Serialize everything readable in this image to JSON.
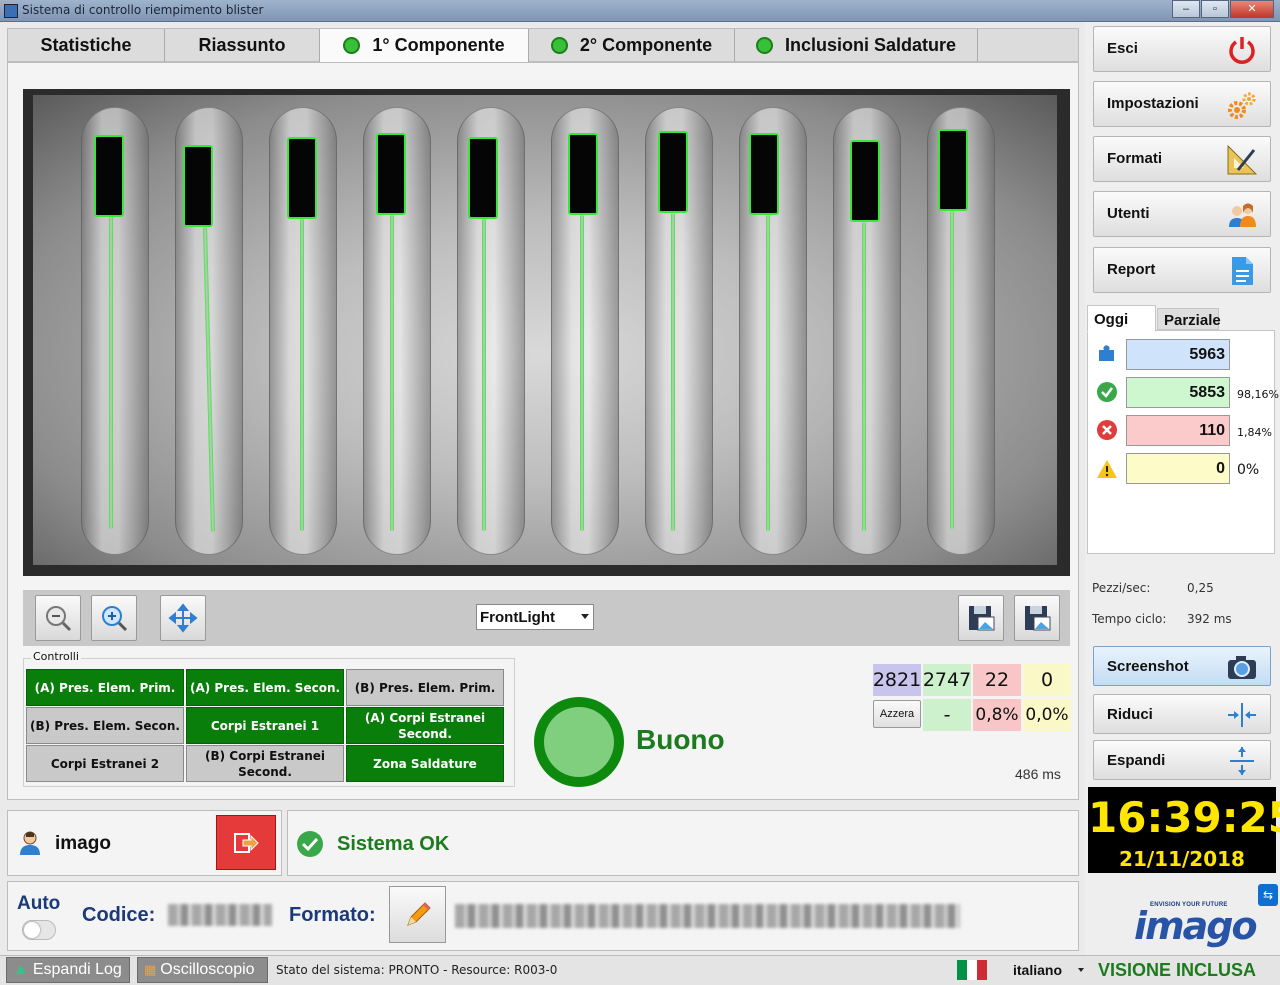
{
  "window": {
    "title": "Sistema di controllo riempimento blister",
    "controls": [
      "minimize",
      "maximize",
      "close"
    ]
  },
  "tabs": [
    {
      "label": "Statistiche",
      "status": null
    },
    {
      "label": "Riassunto",
      "status": null
    },
    {
      "label": "1° Componente",
      "status": "ok",
      "active": true
    },
    {
      "label": "2° Componente",
      "status": "ok"
    },
    {
      "label": "Inclusioni Saldature",
      "status": "ok"
    }
  ],
  "image_toolbar": {
    "light_select": "FrontLight",
    "zoom_out_icon": "zoom-out-icon",
    "zoom_in_icon": "zoom-in-icon",
    "fit_icon": "move-arrows-icon",
    "save_icon": "save-image-icon"
  },
  "controlli": {
    "title": "Controlli",
    "cells": [
      {
        "label": "(A) Pres. Elem. Prim.",
        "state": "ok"
      },
      {
        "label": "(A) Pres. Elem. Secon.",
        "state": "ok"
      },
      {
        "label": "(B) Pres. Elem. Prim.",
        "state": "off"
      },
      {
        "label": "(B) Pres. Elem. Secon.",
        "state": "off"
      },
      {
        "label": "Corpi Estranei 1",
        "state": "ok"
      },
      {
        "label": "(A) Corpi Estranei Second.",
        "state": "ok"
      },
      {
        "label": "Corpi Estranei 2",
        "state": "off"
      },
      {
        "label": "(B) Corpi Estranei Second.",
        "state": "off"
      },
      {
        "label": "Zona Saldature",
        "state": "ok"
      }
    ]
  },
  "result": {
    "label": "Buono",
    "color": "#1e7a1e"
  },
  "counters": {
    "total": "2821",
    "good": "2747",
    "bad": "22",
    "warn": "0",
    "reset_label": "Azzera",
    "good_pct": "-",
    "bad_pct": "0,8%",
    "warn_pct": "0,0%",
    "cycle_time": "486 ms"
  },
  "user": {
    "name": "imago",
    "user_icon": "user-icon",
    "logout_icon": "logout-icon"
  },
  "system_status": {
    "label": "Sistema OK",
    "icon": "check-circle-icon"
  },
  "code_bar": {
    "auto_label": "Auto",
    "auto_enabled": false,
    "codice_label": "Codice:",
    "formato_label": "Formato:",
    "edit_icon": "pencil-icon"
  },
  "bottom": {
    "log_button": "Espandi Log",
    "osc_button": "Oscilloscopio",
    "status_text": "Stato del sistema: PRONTO - Resource: R003-0",
    "language": "italiano",
    "banner": "VISIONE INCLUSA"
  },
  "right_buttons": [
    {
      "label": "Esci",
      "icon": "power-icon"
    },
    {
      "label": "Impostazioni",
      "icon": "gears-icon"
    },
    {
      "label": "Formati",
      "icon": "ruler-pencil-icon"
    },
    {
      "label": "Utenti",
      "icon": "users-icon"
    },
    {
      "label": "Report",
      "icon": "document-icon"
    }
  ],
  "stats": {
    "tabs": [
      "Oggi",
      "Parziale"
    ],
    "active_tab": "Oggi",
    "rows": [
      {
        "icon": "puzzle-icon",
        "value": "5963",
        "pct": "",
        "color": "#cfe3fb"
      },
      {
        "icon": "check-icon",
        "value": "5853",
        "pct": "98,16%",
        "color": "#cff7cf"
      },
      {
        "icon": "error-icon",
        "value": "110",
        "pct": "1,84%",
        "color": "#fbcaca"
      },
      {
        "icon": "warning-icon",
        "value": "0",
        "pct": "0%",
        "color": "#fdfbc8"
      }
    ]
  },
  "metrics": {
    "pezzi_label": "Pezzi/sec:",
    "pezzi_value": "0,25",
    "tempo_label": "Tempo ciclo:",
    "tempo_value": "392 ms"
  },
  "actions": [
    {
      "label": "Screenshot",
      "icon": "camera-icon",
      "highlight": true
    },
    {
      "label": "Riduci",
      "icon": "collapse-icon"
    },
    {
      "label": "Espandi",
      "icon": "expand-icon"
    }
  ],
  "clock": {
    "time": "16:39:25",
    "date": "21/11/2018"
  },
  "logo": {
    "tagline": "ENVISION YOUR FUTURE",
    "word": "imago"
  }
}
